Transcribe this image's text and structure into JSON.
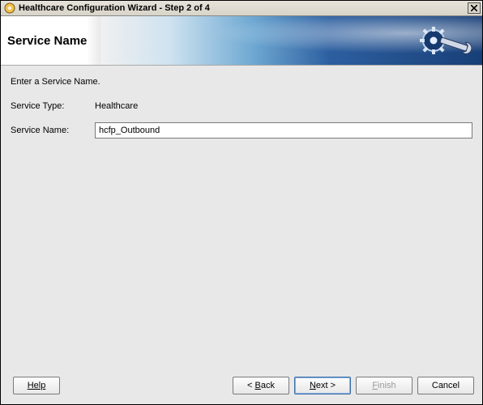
{
  "window": {
    "title": "Healthcare Configuration Wizard - Step 2 of 4"
  },
  "header": {
    "step_title": "Service Name"
  },
  "content": {
    "instruction": "Enter a Service Name.",
    "service_type_label": "Service Type:",
    "service_type_value": "Healthcare",
    "service_name_label": "Service Name:",
    "service_name_value": "hcfp_Outbound"
  },
  "buttons": {
    "help": "Help",
    "back_prefix": "< ",
    "back_mnemonic": "B",
    "back_suffix": "ack",
    "next_mnemonic": "N",
    "next_suffix": "ext >",
    "finish_mnemonic": "F",
    "finish_suffix": "inish",
    "cancel": "Cancel"
  }
}
